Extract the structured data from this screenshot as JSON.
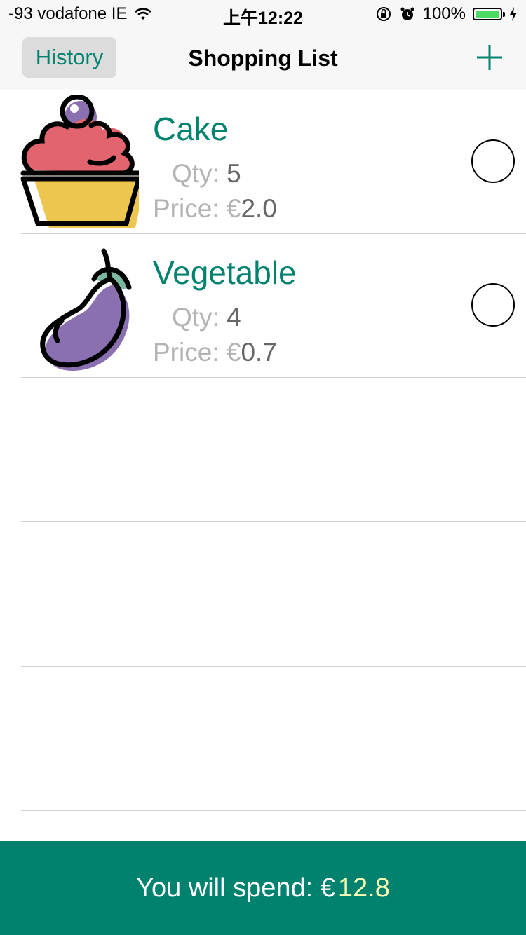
{
  "status_bar": {
    "signal": "-93 vodafone IE",
    "time": "上午12:22",
    "battery": "100%"
  },
  "nav": {
    "history_label": "History",
    "title": "Shopping List"
  },
  "items": [
    {
      "name": "Cake",
      "qty_label": "Qty:",
      "qty": "5",
      "price_label": "Price: €",
      "price": "2.0",
      "icon": "cupcake-icon"
    },
    {
      "name": "Vegetable",
      "qty_label": "Qty:",
      "qty": "4",
      "price_label": "Price: €",
      "price": "0.7",
      "icon": "eggplant-icon"
    }
  ],
  "footer": {
    "label": "You will spend: €",
    "total": "12.8"
  },
  "colors": {
    "accent": "#00826f",
    "total": "#ffffb3"
  }
}
